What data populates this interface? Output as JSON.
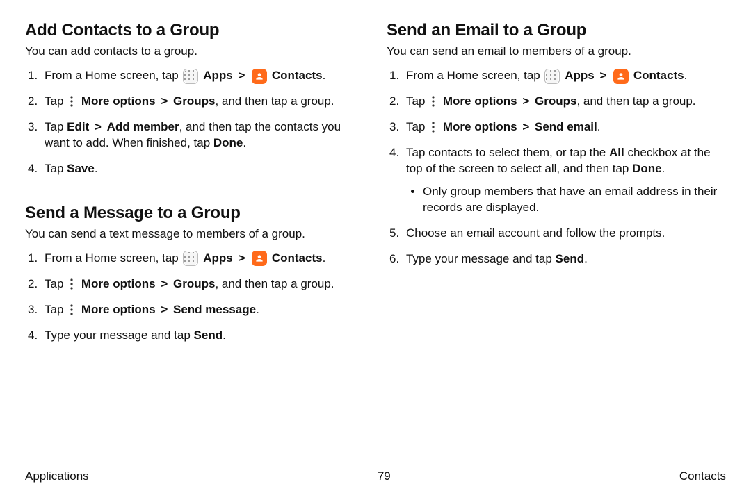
{
  "icons": {
    "apps": "apps-grid",
    "contacts": "person-silhouette",
    "more": "vertical-dots"
  },
  "chev": ">",
  "left": {
    "s1": {
      "title": "Add Contacts to a Group",
      "lead": "You can add contacts to a group.",
      "step1_a": "From a Home screen, tap ",
      "apps_label": "Apps",
      "contacts_label": "Contacts",
      "step2_a": "Tap ",
      "more_label": "More options",
      "groups_label": "Groups",
      "step2_b": ", and then tap a group.",
      "step3_a": "Tap ",
      "edit_label": "Edit",
      "addmember_label": "Add member",
      "step3_b": ", and then tap the contacts you want to add. When finished, tap ",
      "done_label": "Done",
      "step4_a": "Tap ",
      "save_label": "Save"
    },
    "s2": {
      "title": "Send a Message to a Group",
      "lead": "You can send a text message to members of a group.",
      "step1_a": "From a Home screen, tap ",
      "apps_label": "Apps",
      "contacts_label": "Contacts",
      "step2_a": "Tap ",
      "more_label": "More options",
      "groups_label": "Groups",
      "step2_b": ", and then tap a group.",
      "step3_a": "Tap ",
      "more_label2": "More options",
      "sendmsg_label": "Send message",
      "step4_a": "Type your message and tap ",
      "send_label": "Send"
    }
  },
  "right": {
    "s1": {
      "title": "Send an Email to a Group",
      "lead": "You can send an email to members of a group.",
      "step1_a": "From a Home screen, tap ",
      "apps_label": "Apps",
      "contacts_label": "Contacts",
      "step2_a": "Tap ",
      "more_label": "More options",
      "groups_label": "Groups",
      "step2_b": ", and then tap a group.",
      "step3_a": "Tap ",
      "more_label2": "More options",
      "sendemail_label": "Send email",
      "step4_a": "Tap contacts to select them, or tap the ",
      "all_label": "All",
      "step4_b": " checkbox at the top of the screen to select all, and then tap ",
      "done_label": "Done",
      "bullet": "Only group members that have an email address in their records are displayed.",
      "step5": "Choose an email account and follow the prompts.",
      "step6_a": "Type your message and tap ",
      "send_label": "Send"
    }
  },
  "footer": {
    "left": "Applications",
    "center": "79",
    "right": "Contacts"
  }
}
